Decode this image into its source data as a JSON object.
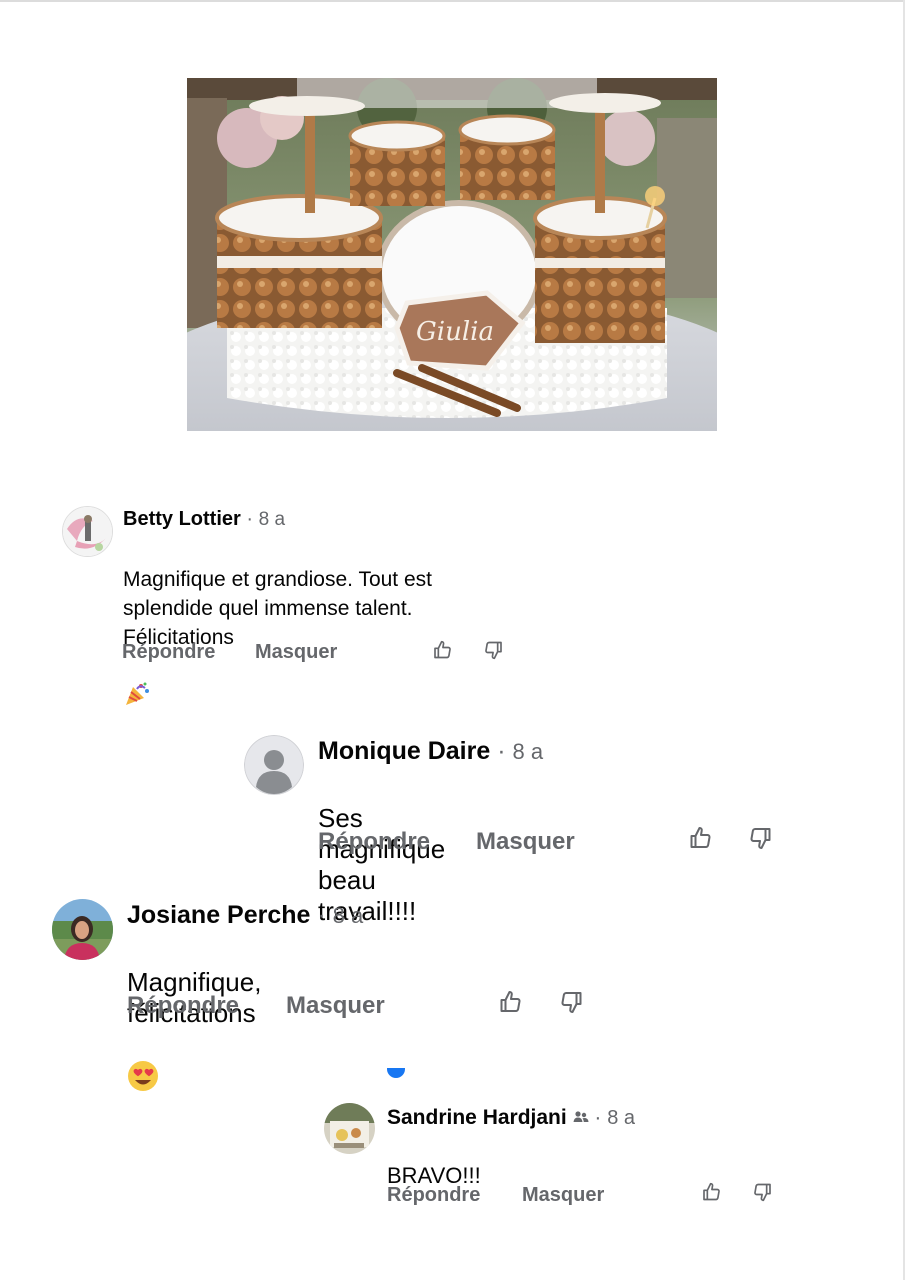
{
  "comments": [
    {
      "author": "Betty Lottier",
      "separator": "·",
      "time": "8 a",
      "text": "Magnifique et grandiose. Tout est\nsplendide quel immense talent.\nFélicitations",
      "text_emoji": "party-popper",
      "reply_label": "Répondre",
      "hide_label": "Masquer"
    },
    {
      "author": "Monique Daire",
      "separator": "·",
      "time": "8 a",
      "text": "Ses magnifique beau travail!!!!",
      "reply_label": "Répondre",
      "hide_label": "Masquer"
    },
    {
      "author": "Josiane Perche",
      "separator": "·",
      "time": "8 a",
      "text": "Magnifique, félicitations",
      "text_emoji": "heart-eyes",
      "reply_label": "Répondre",
      "hide_label": "Masquer"
    },
    {
      "author": "Sandrine Hardjani",
      "separator": "·",
      "time": "8 a",
      "author_badge": "group-members-icon",
      "text": "BRAVO!!!",
      "reply_label": "Répondre",
      "hide_label": "Masquer"
    }
  ],
  "photo": {
    "cake_name": "Giulia",
    "subject": "drum-kit shaped croquembouche cake"
  },
  "colors": {
    "secondary_text": "#65676b",
    "primary_text": "#050505",
    "accent": "#1877f2"
  }
}
